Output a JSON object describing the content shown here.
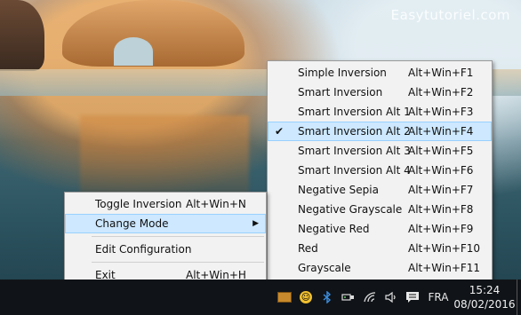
{
  "watermark": "Easytutoriel.com",
  "context_menu": {
    "items": [
      {
        "label": "Toggle Inversion",
        "shortcut": "Alt+Win+N"
      },
      {
        "label": "Change Mode",
        "submenu": true
      },
      {
        "label": "Edit Configuration",
        "shortcut": ""
      },
      {
        "label": "Exit",
        "shortcut": "Alt+Win+H"
      }
    ]
  },
  "submenu": {
    "items": [
      {
        "label": "Simple Inversion",
        "shortcut": "Alt+Win+F1"
      },
      {
        "label": "Smart Inversion",
        "shortcut": "Alt+Win+F2"
      },
      {
        "label": "Smart Inversion Alt 1",
        "shortcut": "Alt+Win+F3"
      },
      {
        "label": "Smart Inversion Alt 2",
        "shortcut": "Alt+Win+F4",
        "checked": true
      },
      {
        "label": "Smart Inversion Alt 3",
        "shortcut": "Alt+Win+F5"
      },
      {
        "label": "Smart Inversion Alt 4",
        "shortcut": "Alt+Win+F6"
      },
      {
        "label": "Negative Sepia",
        "shortcut": "Alt+Win+F7"
      },
      {
        "label": "Negative Grayscale",
        "shortcut": "Alt+Win+F8"
      },
      {
        "label": "Negative Red",
        "shortcut": "Alt+Win+F9"
      },
      {
        "label": "Red",
        "shortcut": "Alt+Win+F10"
      },
      {
        "label": "Grayscale",
        "shortcut": "Alt+Win+F11"
      }
    ],
    "check_glyph": "✔"
  },
  "taskbar": {
    "language": "FRA",
    "time": "15:24",
    "date": "08/02/2016",
    "icons": [
      "tray-app-icon",
      "emoji-icon",
      "bluetooth-icon",
      "usb-icon",
      "wifi-icon",
      "volume-icon",
      "action-center-icon"
    ]
  },
  "colors": {
    "menu_bg": "#f2f2f2",
    "highlight": "#cde8ff",
    "highlight_border": "#99d1ff",
    "taskbar": "#101418"
  }
}
